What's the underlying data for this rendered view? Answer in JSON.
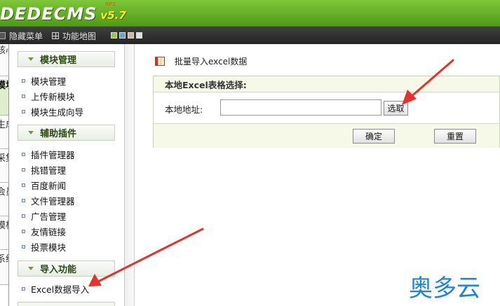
{
  "header": {
    "logo_text": "DEDECMS",
    "version": "v5.7",
    "version_tag": "SP2"
  },
  "toolbar": {
    "hide_menu": "隐藏菜单",
    "function_map": "功能地图",
    "skins": [
      "#8ccf2e",
      "#5aa6e6",
      "#d2b88a",
      "#e0e0e0"
    ]
  },
  "tabs": [
    "核心",
    "模块",
    "生成",
    "采集",
    "会员",
    "模板",
    "系统"
  ],
  "menu": {
    "groups": [
      {
        "title": "模块管理",
        "items": [
          "模块管理",
          "上传新模块",
          "模块生成向导"
        ]
      },
      {
        "title": "辅助插件",
        "items": [
          "插件管理器",
          "挑错管理",
          "百度新闻",
          "文件管理器",
          "广告管理",
          "友情链接",
          "投票模块"
        ]
      },
      {
        "title": "导入功能",
        "items": [
          "Excel数据导入"
        ]
      }
    ]
  },
  "main": {
    "page_title": "批量导入excel数据",
    "section_title": "本地Excel表格选择:",
    "path_label": "本地地址:",
    "path_value": "",
    "browse_label": "选取",
    "ok_label": "确定",
    "reset_label": "重置"
  },
  "watermark": "奥多云",
  "colors": {
    "header_green": "#6bb52a",
    "toolbar_dark": "#333333",
    "arrow_red": "#e8312a",
    "watermark_blue": "#1e86d6"
  }
}
